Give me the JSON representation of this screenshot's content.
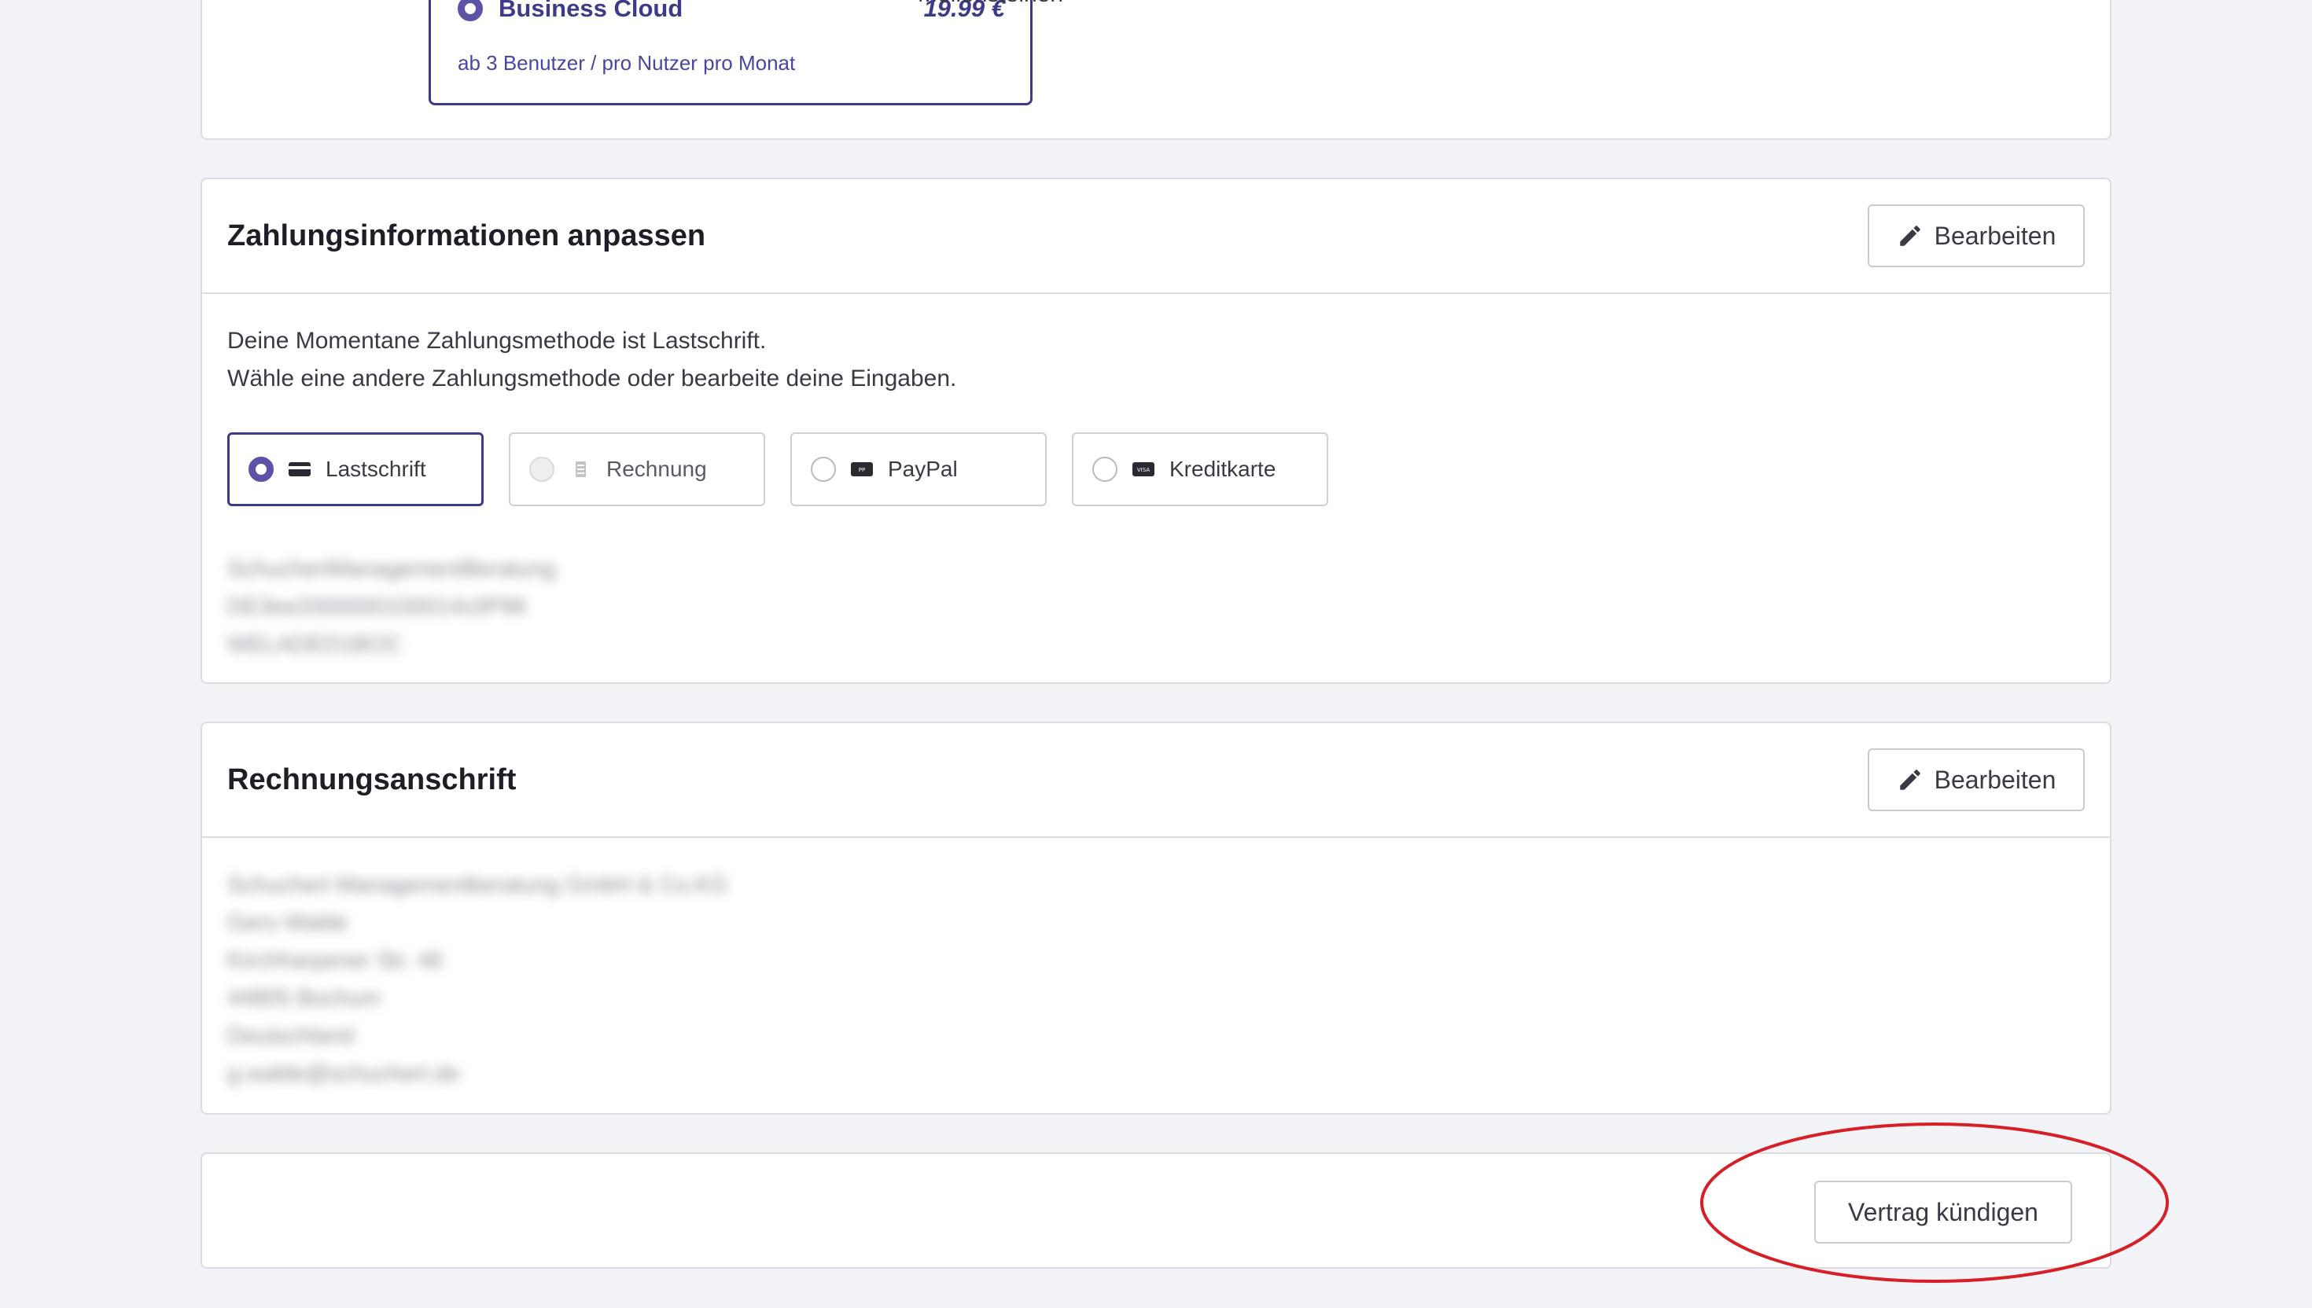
{
  "plan": {
    "name": "Business Cloud",
    "price": "19.99 €",
    "subtitle": "ab 3 Benutzer / pro Nutzer pro Monat",
    "side_text": "Meilensteinen"
  },
  "payment": {
    "title": "Zahlungsinformationen anpassen",
    "edit_label": "Bearbeiten",
    "line1": "Deine Momentane Zahlungsmethode ist Lastschrift.",
    "line2": "Wähle eine andere Zahlungsmethode oder bearbeite deine Eingaben.",
    "methods": [
      {
        "label": "Lastschrift",
        "icon": "card-icon",
        "state": "selected"
      },
      {
        "label": "Rechnung",
        "icon": "invoice-icon",
        "state": "disabled"
      },
      {
        "label": "PayPal",
        "icon": "paypal-icon",
        "state": "unselected"
      },
      {
        "label": "Kreditkarte",
        "icon": "visa-icon",
        "state": "unselected"
      }
    ],
    "details_blurred": [
      "SchuchertManagementBeratung",
      "DE3ee2000000100014c0P96",
      "WELADED1BOC"
    ]
  },
  "billing": {
    "title": "Rechnungsanschrift",
    "edit_label": "Bearbeiten",
    "address_blurred": [
      "Schuchert Managementberatung GmbH & Co.KG",
      "Gero Walde",
      "Kirchharpener Str. 46",
      "44805 Bochum",
      "Deutschland",
      "g.walde@schuchert.de"
    ]
  },
  "contract": {
    "cancel_label": "Vertrag kündigen"
  },
  "colors": {
    "accent": "#3d3a8a",
    "radio_selected": "#5c53a8",
    "annotation_circle": "#d61f26",
    "background": "#f2f3f7"
  }
}
